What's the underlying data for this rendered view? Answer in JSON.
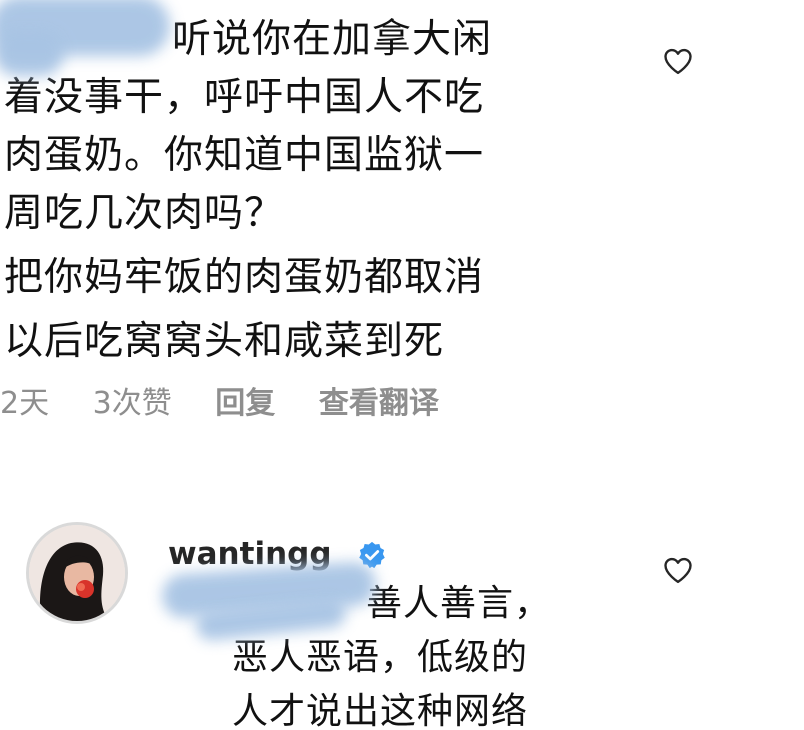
{
  "comment1": {
    "lines": [
      "听说你在加拿大闲",
      "着没事干，呼吁中国人不吃",
      "肉蛋奶。你知道中国监狱一",
      "周吃几次肉吗？",
      "把你妈牢饭的肉蛋奶都取消",
      "以后吃窝窝头和咸菜到死"
    ],
    "time": "2天",
    "likes": "3次赞",
    "reply": "回复",
    "translate": "查看翻译"
  },
  "comment2": {
    "username": "wantingg",
    "lines": [
      "善人善言，",
      "恶人恶语，低级的",
      "人才说出这种网络"
    ]
  },
  "icons": {
    "like": "heart-outline-icon",
    "verified": "verified-badge-icon"
  },
  "colors": {
    "text": "#111111",
    "meta": "#8e8e8e",
    "verified": "#3897f0",
    "redaction": "#a8c4e4"
  }
}
